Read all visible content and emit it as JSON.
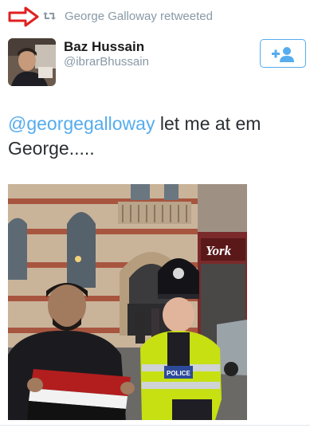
{
  "retweet": {
    "text": "George Galloway retweeted",
    "arrow_color": "#e02020",
    "icon": "retweet-icon"
  },
  "author": {
    "name": "Baz Hussain",
    "handle": "@ibrarBhussain",
    "avatar_icon": "avatar-photo"
  },
  "follow_button": {
    "icon": "add-user-icon",
    "color": "#55acee"
  },
  "tweet": {
    "mention": "@georgegalloway",
    "text": " let me at em George....."
  },
  "photo": {
    "sign_text": "York",
    "vest_badge": "POLICE"
  },
  "colors": {
    "link": "#55acee",
    "muted": "#8899a6",
    "text": "#292f33"
  }
}
